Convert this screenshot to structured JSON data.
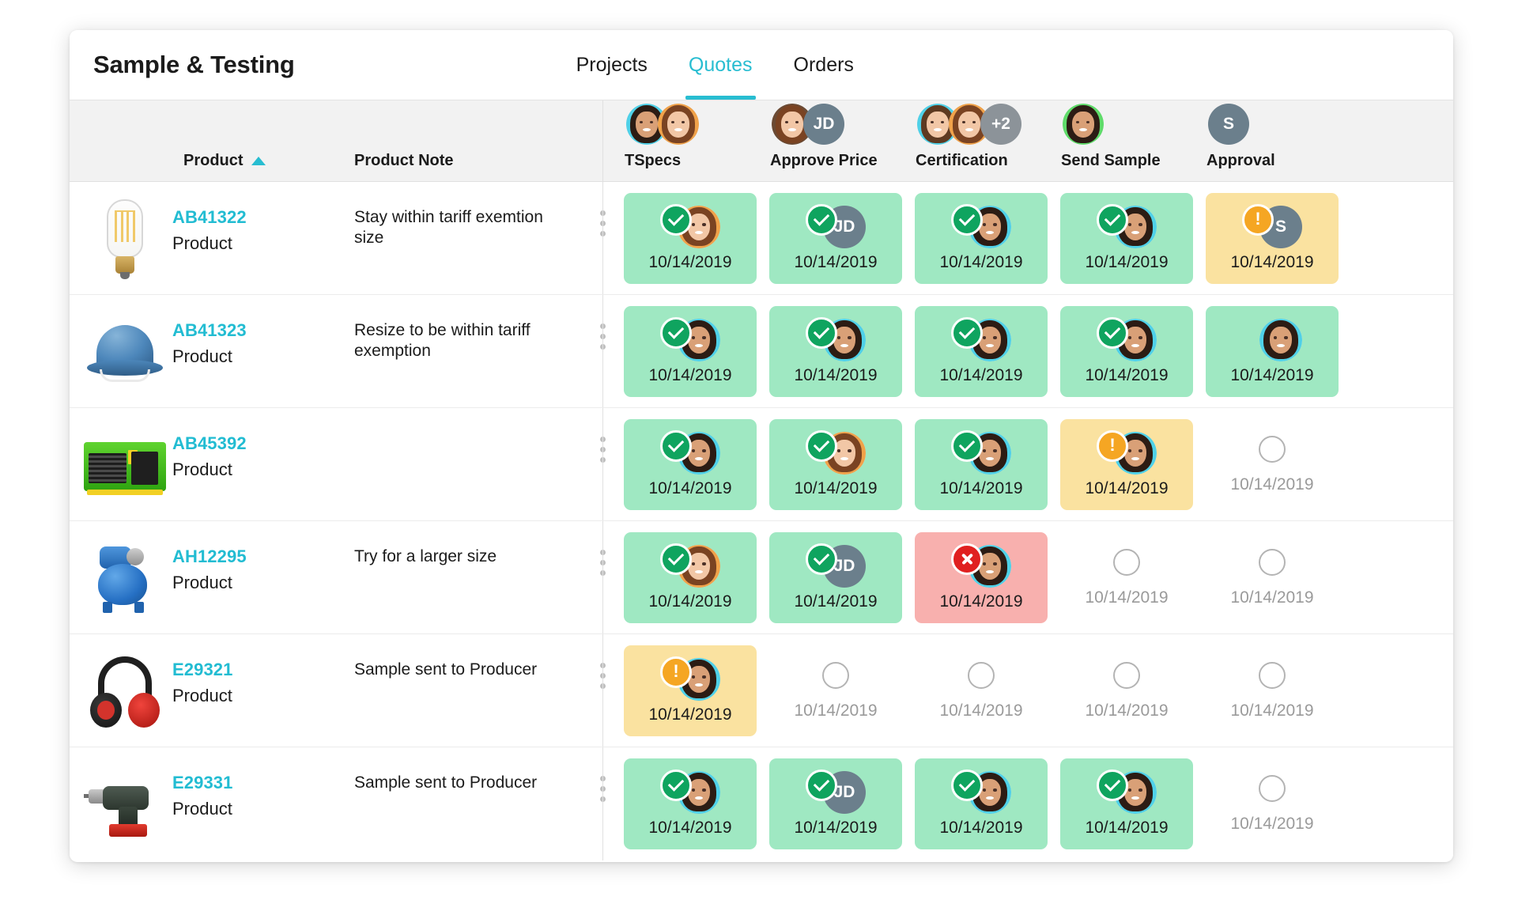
{
  "window": {
    "title": "Sample & Testing"
  },
  "tabs": [
    {
      "label": "Projects",
      "active": false
    },
    {
      "label": "Quotes",
      "active": true
    },
    {
      "label": "Orders",
      "active": false
    }
  ],
  "columns": {
    "product": {
      "label": "Product",
      "sort": "ascending"
    },
    "note": {
      "label": "Product Note"
    },
    "status": [
      {
        "label": "TSpecs",
        "avatars": [
          {
            "type": "photo",
            "ring": "cyan",
            "hair": "dark",
            "skin": "c"
          },
          {
            "type": "photo",
            "ring": "orange",
            "hair": "auburn",
            "skin": "b"
          }
        ]
      },
      {
        "label": "Approve Price",
        "avatars": [
          {
            "type": "photo",
            "ring": "brown",
            "hair": "auburn",
            "skin": "b"
          },
          {
            "type": "initials",
            "text": "JD"
          }
        ]
      },
      {
        "label": "Certification",
        "avatars": [
          {
            "type": "photo",
            "ring": "cyan",
            "hair": "brown",
            "skin": "b"
          },
          {
            "type": "photo",
            "ring": "orange",
            "hair": "auburn",
            "skin": "b"
          },
          {
            "type": "initials",
            "text": "+2",
            "plus": true
          }
        ]
      },
      {
        "label": "Send Sample",
        "avatars": [
          {
            "type": "photo",
            "ring": "green",
            "hair": "dark",
            "skin": "c"
          }
        ]
      },
      {
        "label": "Approval",
        "avatars": [
          {
            "type": "initials",
            "text": "S"
          }
        ]
      }
    ]
  },
  "rows": [
    {
      "thumb": "lightbulb",
      "id": "AB41322",
      "subtitle": "Product",
      "note": "Stay within tariff exemtion size",
      "cells": [
        {
          "state": "ok",
          "date": "10/14/2019",
          "badge": "check",
          "avatar": {
            "type": "photo",
            "ring": "orange",
            "hair": "auburn",
            "skin": "b"
          }
        },
        {
          "state": "ok",
          "date": "10/14/2019",
          "badge": "check",
          "avatar": {
            "type": "initials",
            "text": "JD"
          }
        },
        {
          "state": "ok",
          "date": "10/14/2019",
          "badge": "check",
          "avatar": {
            "type": "photo",
            "ring": "cyan",
            "hair": "dark",
            "skin": "c"
          }
        },
        {
          "state": "ok",
          "date": "10/14/2019",
          "badge": "check",
          "avatar": {
            "type": "photo",
            "ring": "cyan",
            "hair": "dark",
            "skin": "c"
          }
        },
        {
          "state": "warn",
          "date": "10/14/2019",
          "badge": "alert",
          "avatar": {
            "type": "initials",
            "text": "S"
          }
        }
      ]
    },
    {
      "thumb": "helmet",
      "id": "AB41323",
      "subtitle": "Product",
      "note": "Resize to be within tariff exemption",
      "cells": [
        {
          "state": "ok",
          "date": "10/14/2019",
          "badge": "check",
          "avatar": {
            "type": "photo",
            "ring": "cyan",
            "hair": "dark",
            "skin": "c"
          }
        },
        {
          "state": "ok",
          "date": "10/14/2019",
          "badge": "check",
          "avatar": {
            "type": "photo",
            "ring": "cyan",
            "hair": "dark",
            "skin": "c"
          }
        },
        {
          "state": "ok",
          "date": "10/14/2019",
          "badge": "check",
          "avatar": {
            "type": "photo",
            "ring": "cyan",
            "hair": "dark",
            "skin": "c"
          }
        },
        {
          "state": "ok",
          "date": "10/14/2019",
          "badge": "check",
          "avatar": {
            "type": "photo",
            "ring": "cyan",
            "hair": "dark",
            "skin": "c"
          }
        },
        {
          "state": "ok",
          "date": "10/14/2019",
          "badge": "none",
          "avatar": {
            "type": "photo",
            "ring": "cyan",
            "hair": "dark",
            "skin": "c"
          }
        }
      ]
    },
    {
      "thumb": "generator",
      "id": "AB45392",
      "subtitle": "Product",
      "note": "",
      "cells": [
        {
          "state": "ok",
          "date": "10/14/2019",
          "badge": "check",
          "avatar": {
            "type": "photo",
            "ring": "cyan",
            "hair": "dark",
            "skin": "c"
          }
        },
        {
          "state": "ok",
          "date": "10/14/2019",
          "badge": "check",
          "avatar": {
            "type": "photo",
            "ring": "orange",
            "hair": "auburn",
            "skin": "b"
          }
        },
        {
          "state": "ok",
          "date": "10/14/2019",
          "badge": "check",
          "avatar": {
            "type": "photo",
            "ring": "cyan",
            "hair": "dark",
            "skin": "c"
          }
        },
        {
          "state": "warn",
          "date": "10/14/2019",
          "badge": "alert",
          "avatar": {
            "type": "photo",
            "ring": "cyan",
            "hair": "dark",
            "skin": "c"
          }
        },
        {
          "state": "empty",
          "date": "10/14/2019",
          "badge": "none",
          "avatar": null
        }
      ]
    },
    {
      "thumb": "pump",
      "id": "AH12295",
      "subtitle": "Product",
      "note": "Try for a larger size",
      "cells": [
        {
          "state": "ok",
          "date": "10/14/2019",
          "badge": "check",
          "avatar": {
            "type": "photo",
            "ring": "orange",
            "hair": "auburn",
            "skin": "b"
          }
        },
        {
          "state": "ok",
          "date": "10/14/2019",
          "badge": "check",
          "avatar": {
            "type": "initials",
            "text": "JD"
          }
        },
        {
          "state": "err",
          "date": "10/14/2019",
          "badge": "cross",
          "avatar": {
            "type": "photo",
            "ring": "cyan",
            "hair": "dark",
            "skin": "c"
          }
        },
        {
          "state": "empty",
          "date": "10/14/2019",
          "badge": "none",
          "avatar": null
        },
        {
          "state": "empty",
          "date": "10/14/2019",
          "badge": "none",
          "avatar": null
        }
      ]
    },
    {
      "thumb": "earmuffs",
      "id": "E29321",
      "subtitle": "Product",
      "note": "Sample sent to Producer",
      "cells": [
        {
          "state": "warn",
          "date": "10/14/2019",
          "badge": "alert",
          "avatar": {
            "type": "photo",
            "ring": "cyan",
            "hair": "dark",
            "skin": "c"
          }
        },
        {
          "state": "empty",
          "date": "10/14/2019",
          "badge": "none",
          "avatar": null
        },
        {
          "state": "empty",
          "date": "10/14/2019",
          "badge": "none",
          "avatar": null
        },
        {
          "state": "empty",
          "date": "10/14/2019",
          "badge": "none",
          "avatar": null
        },
        {
          "state": "empty",
          "date": "10/14/2019",
          "badge": "none",
          "avatar": null
        }
      ]
    },
    {
      "thumb": "drill",
      "id": "E29331",
      "subtitle": "Product",
      "note": "Sample sent to Producer",
      "cells": [
        {
          "state": "ok",
          "date": "10/14/2019",
          "badge": "check",
          "avatar": {
            "type": "photo",
            "ring": "cyan",
            "hair": "dark",
            "skin": "c"
          }
        },
        {
          "state": "ok",
          "date": "10/14/2019",
          "badge": "check",
          "avatar": {
            "type": "initials",
            "text": "JD"
          }
        },
        {
          "state": "ok",
          "date": "10/14/2019",
          "badge": "check",
          "avatar": {
            "type": "photo",
            "ring": "cyan",
            "hair": "dark",
            "skin": "c"
          }
        },
        {
          "state": "ok",
          "date": "10/14/2019",
          "badge": "check",
          "avatar": {
            "type": "photo",
            "ring": "cyan",
            "hair": "dark",
            "skin": "c"
          }
        },
        {
          "state": "empty",
          "date": "10/14/2019",
          "badge": "none",
          "avatar": null
        }
      ]
    }
  ],
  "colors": {
    "accent": "#28bdd1",
    "link": "#22bcd2",
    "ok_bg": "#9fe8c2",
    "warn_bg": "#fae2a0",
    "error_bg": "#f8b0ae",
    "check_badge": "#0fa45f",
    "alert_badge": "#f5a623",
    "cross_badge": "#e02020",
    "header_bg": "#f2f2f2"
  },
  "icons": {
    "sort_asc": "caret-up-icon",
    "row_menu": "kebab-menu-icon"
  }
}
